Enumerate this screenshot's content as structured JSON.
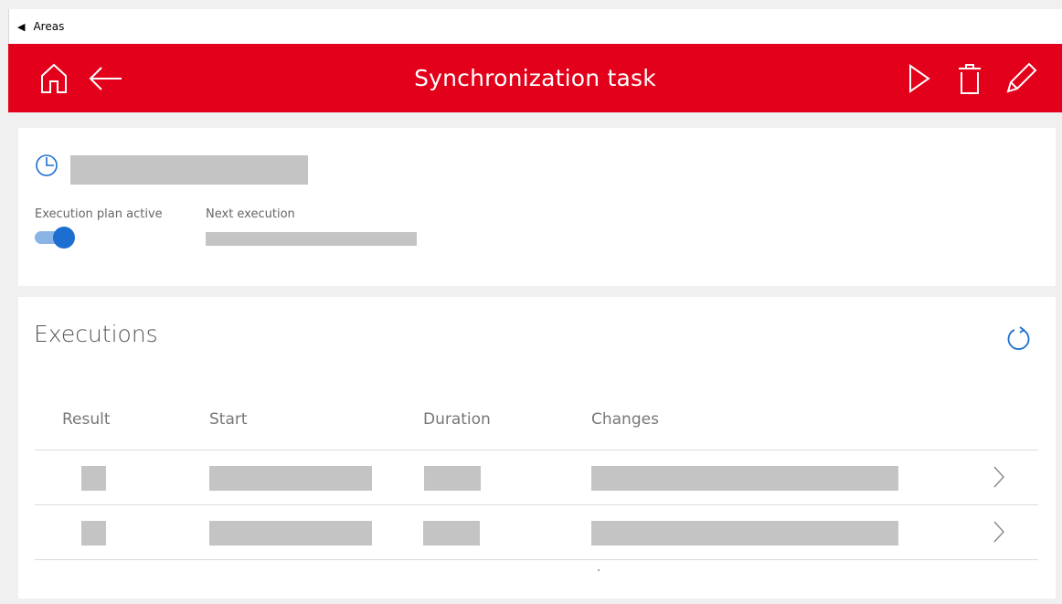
{
  "topbar": {
    "back_label": "Areas"
  },
  "header": {
    "title": "Synchronization task",
    "color": "#e2001a"
  },
  "task": {
    "execution_plan_label": "Execution plan active",
    "execution_plan_active": true,
    "next_execution_label": "Next execution"
  },
  "executions": {
    "title": "Executions",
    "columns": [
      "Result",
      "Start",
      "Duration",
      "Changes"
    ],
    "row_count": 2
  }
}
